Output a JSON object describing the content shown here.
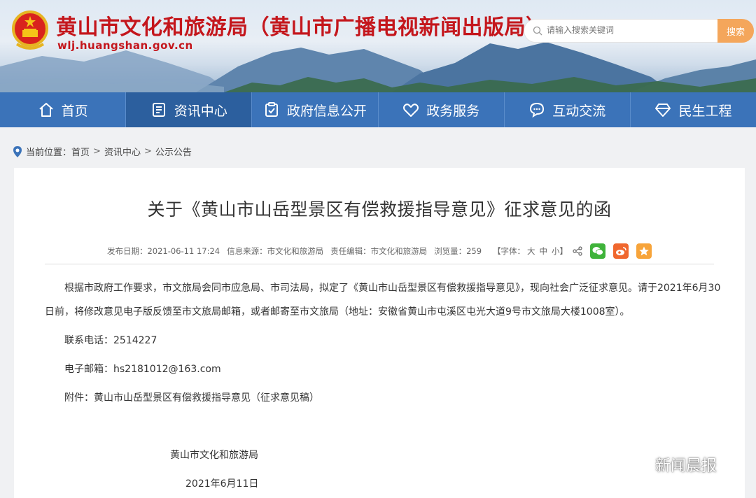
{
  "header": {
    "title": "黄山市文化和旅游局（黄山市广播电视新闻出版局）",
    "url": "wlj.huangshan.gov.cn",
    "search_placeholder": "请输入搜索关键词",
    "search_button": "搜索"
  },
  "nav": {
    "items": [
      {
        "label": "首页",
        "icon": "home-icon"
      },
      {
        "label": "资讯中心",
        "icon": "document-icon"
      },
      {
        "label": "政府信息公开",
        "icon": "clipboard-check-icon"
      },
      {
        "label": "政务服务",
        "icon": "handshake-heart-icon"
      },
      {
        "label": "互动交流",
        "icon": "chat-icon"
      },
      {
        "label": "民生工程",
        "icon": "diamond-icon"
      }
    ],
    "active_index": 1
  },
  "breadcrumb": {
    "prefix": "当前位置：",
    "items": [
      "首页",
      "资讯中心",
      "公示公告"
    ],
    "separator": ">"
  },
  "article": {
    "title": "关于《黄山市山岳型景区有偿救援指导意见》征求意见的函",
    "meta": {
      "publish_date": "发布日期：2021-06-11 17:24",
      "source": "信息来源：市文化和旅游局",
      "editor": "责任编辑：市文化和旅游局",
      "views": "浏览量：259",
      "font_label": "【字体：",
      "font_large": "大",
      "font_medium": "中",
      "font_small": "小】"
    },
    "paragraph1": "根据市政府工作要求，市文旅局会同市应急局、市司法局，拟定了《黄山市山岳型景区有偿救援指导意见》，现向社会广泛征求意见。请于2021年6月30日前，将修改意见电子版反馈至市文旅局邮箱，或者邮寄至市文旅局（地址：安徽省黄山市屯溪区屯光大道9号市文旅局大楼1008室）。",
    "phone": "联系电话：2514227",
    "email": "电子邮箱：hs2181012@163.com",
    "attachment": "附件：黄山市山岳型景区有偿救援指导意见（征求意见稿）",
    "signature": "黄山市文化和旅游局",
    "date": "2021年6月11日"
  },
  "watermark": "新闻晨报",
  "colors": {
    "brand_red": "#c4161c",
    "nav_blue": "#3b73b9",
    "nav_active": "#2c5f9e",
    "search_orange": "#f4a65b",
    "wechat_green": "#3fb33a",
    "weibo_orange": "#f0672e",
    "favorite_orange": "#f7a43a"
  }
}
